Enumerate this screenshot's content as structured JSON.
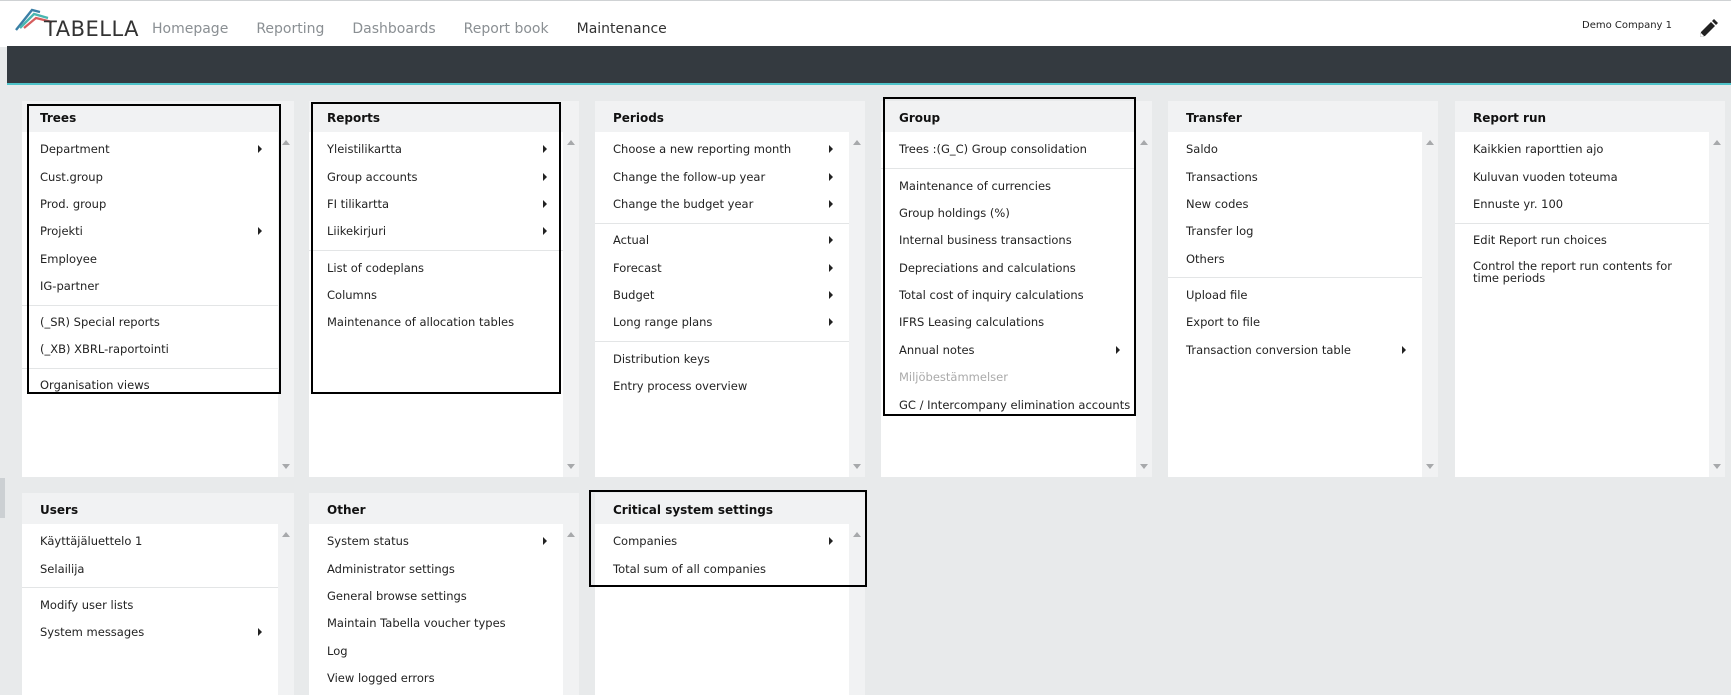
{
  "app": {
    "logo_text": "TABELLA",
    "company": "Demo Company 1"
  },
  "nav": [
    {
      "label": "Homepage",
      "active": false
    },
    {
      "label": "Reporting",
      "active": false
    },
    {
      "label": "Dashboards",
      "active": false
    },
    {
      "label": "Report book",
      "active": false
    },
    {
      "label": "Maintenance",
      "active": true
    }
  ],
  "panels": {
    "trees": {
      "title": "Trees",
      "items": [
        {
          "label": "Department",
          "submenu": true
        },
        {
          "label": "Cust.group"
        },
        {
          "label": "Prod. group"
        },
        {
          "label": "Projekti",
          "submenu": true
        },
        {
          "label": "Employee"
        },
        {
          "label": "IG-partner"
        },
        {
          "label": "(_SR) Special reports"
        },
        {
          "label": "(_XB) XBRL-raportointi"
        },
        {
          "label": "Organisation views"
        }
      ]
    },
    "reports": {
      "title": "Reports",
      "items": [
        {
          "label": "Yleistilikartta",
          "submenu": true
        },
        {
          "label": "Group accounts",
          "submenu": true
        },
        {
          "label": "FI tilikartta",
          "submenu": true
        },
        {
          "label": "Liikekirjuri",
          "submenu": true
        },
        {
          "label": "List of codeplans"
        },
        {
          "label": "Columns"
        },
        {
          "label": "Maintenance of allocation tables"
        }
      ]
    },
    "periods": {
      "title": "Periods",
      "items": [
        {
          "label": "Choose a new reporting month",
          "submenu": true
        },
        {
          "label": "Change the follow-up year",
          "submenu": true
        },
        {
          "label": "Change the budget year",
          "submenu": true
        },
        {
          "label": "Actual",
          "submenu": true
        },
        {
          "label": "Forecast",
          "submenu": true
        },
        {
          "label": "Budget",
          "submenu": true
        },
        {
          "label": "Long range plans",
          "submenu": true
        },
        {
          "label": "Distribution keys"
        },
        {
          "label": "Entry process overview"
        }
      ]
    },
    "group": {
      "title": "Group",
      "items": [
        {
          "label": "Trees :(G_C) Group consolidation"
        },
        {
          "label": "Maintenance of currencies"
        },
        {
          "label": "Group holdings (%)"
        },
        {
          "label": "Internal business transactions"
        },
        {
          "label": "Depreciations and calculations"
        },
        {
          "label": "Total cost of inquiry calculations"
        },
        {
          "label": "IFRS Leasing calculations"
        },
        {
          "label": "Annual notes",
          "submenu": true
        },
        {
          "label": "Miljöbestämmelser",
          "disabled": true
        },
        {
          "label": "GC / Intercompany elimination accounts"
        }
      ]
    },
    "transfer": {
      "title": "Transfer",
      "items": [
        {
          "label": "Saldo"
        },
        {
          "label": "Transactions"
        },
        {
          "label": "New codes"
        },
        {
          "label": "Transfer log"
        },
        {
          "label": "Others"
        },
        {
          "label": "Upload file"
        },
        {
          "label": "Export to file"
        },
        {
          "label": "Transaction conversion table",
          "submenu": true
        }
      ]
    },
    "report_run": {
      "title": "Report run",
      "items": [
        {
          "label": "Kaikkien raporttien ajo"
        },
        {
          "label": "Kuluvan vuoden toteuma"
        },
        {
          "label": "Ennuste yr. 100"
        },
        {
          "label": "Edit Report run choices"
        },
        {
          "label": "Control the report run contents for time periods"
        }
      ]
    },
    "users": {
      "title": "Users",
      "items": [
        {
          "label": "Käyttäjäluettelo 1"
        },
        {
          "label": "Selailija"
        },
        {
          "label": "Modify user lists"
        },
        {
          "label": "System messages",
          "submenu": true
        }
      ]
    },
    "other": {
      "title": "Other",
      "items": [
        {
          "label": "System status",
          "submenu": true
        },
        {
          "label": "Administrator settings"
        },
        {
          "label": "General browse settings"
        },
        {
          "label": "Maintain Tabella voucher types"
        },
        {
          "label": "Log"
        },
        {
          "label": "View logged errors"
        }
      ]
    },
    "critical": {
      "title": "Critical system settings",
      "items": [
        {
          "label": "Companies",
          "submenu": true
        },
        {
          "label": "Total sum of all companies"
        }
      ]
    }
  }
}
